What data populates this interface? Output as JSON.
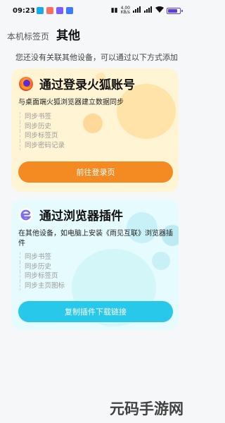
{
  "status_bar": {
    "time": "09:23",
    "net_speed_value": "4.00",
    "net_speed_unit": "KB/s",
    "app_icon_colors": [
      "#1aa7ec",
      "#ff6f61",
      "#7a5cff",
      "#3d7bfd"
    ]
  },
  "header": {
    "back_tab": "本机标签页",
    "title": "其他"
  },
  "intro": "您还没有关联其他设备，可以通过以下方式添加",
  "cards": [
    {
      "title": "通过登录火狐账号",
      "description": "与桌面端火狐浏览器建立数据同步",
      "features": [
        "同步书签",
        "同步历史",
        "同步标签页",
        "同步密码记录"
      ],
      "button_label": "前往登录页",
      "icon": "firefox-logo-icon",
      "accent": "#f38a22",
      "background": "#fff4d3"
    },
    {
      "title": "通过浏览器插件",
      "description": "在其他设备，如电脑上安装《雨见互联》浏览器插件",
      "features": [
        "同步书签",
        "同步历史",
        "同步标签页",
        "同步主页图标"
      ],
      "button_label": "复制插件下载链接",
      "icon": "browser-plugin-logo-icon",
      "accent": "#27c8e9",
      "background": "#e6fbfd"
    }
  ],
  "watermark": "元码手游网"
}
